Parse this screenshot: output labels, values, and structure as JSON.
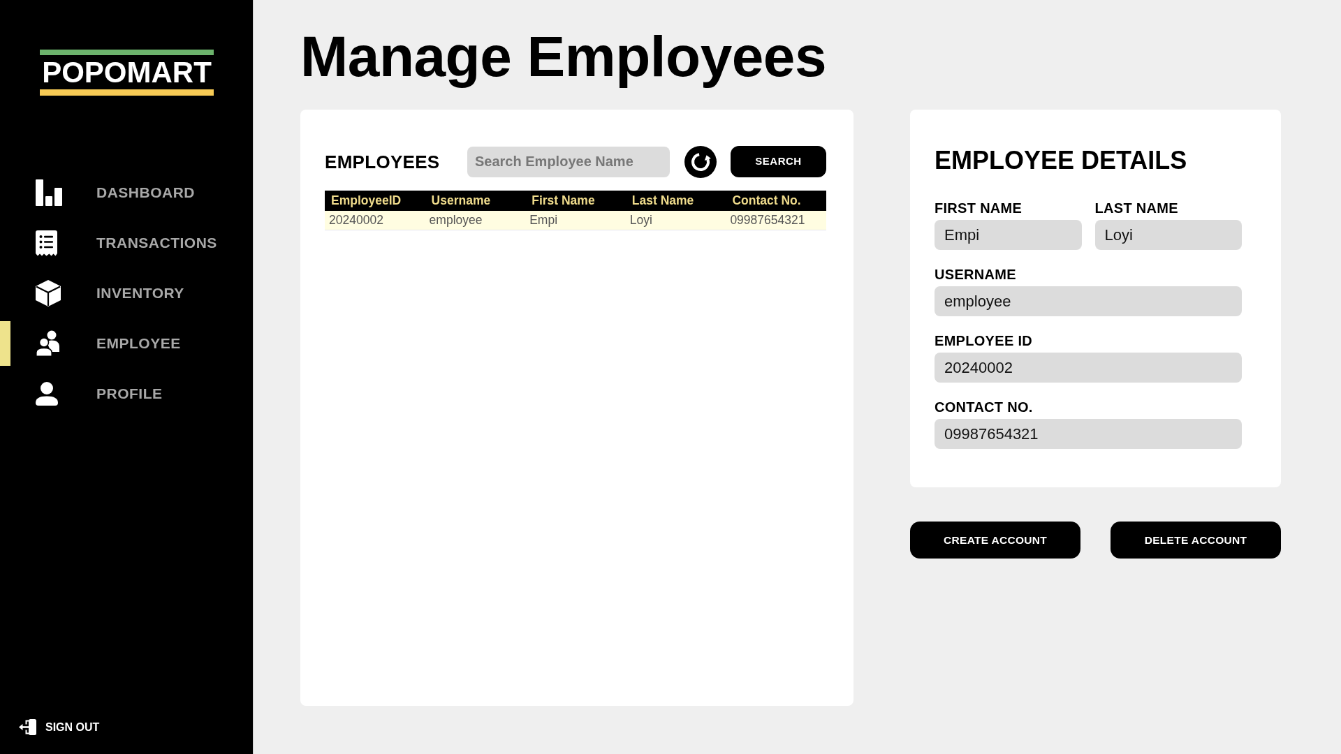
{
  "sidebar": {
    "logo": "POPOMART",
    "items": [
      {
        "label": "DASHBOARD",
        "selected": false
      },
      {
        "label": "TRANSACTIONS",
        "selected": false
      },
      {
        "label": "INVENTORY",
        "selected": false
      },
      {
        "label": "EMPLOYEE",
        "selected": true
      },
      {
        "label": "PROFILE",
        "selected": false
      }
    ],
    "sign_out": "SIGN OUT"
  },
  "page_title": "Manage Employees",
  "employees_panel": {
    "title": "EMPLOYEES",
    "search": {
      "placeholder": "Search Employee Name"
    },
    "search_button": "SEARCH",
    "table": {
      "columns": [
        "EmployeeID",
        "Username",
        "First Name",
        "Last Name",
        "Contact No."
      ],
      "rows": [
        {
          "cells": [
            "20240002",
            "employee",
            "Empi",
            "Loyi",
            "09987654321"
          ],
          "selected": true
        }
      ]
    }
  },
  "details_panel": {
    "title": "EMPLOYEE DETAILS",
    "rows": [
      [
        {
          "label": "FIRST NAME",
          "value": "Empi"
        },
        {
          "label": "LAST NAME",
          "value": "Loyi"
        }
      ],
      [
        {
          "label": "USERNAME",
          "value": "employee"
        }
      ],
      [
        {
          "label": "EMPLOYEE ID",
          "value": "20240002"
        }
      ],
      [
        {
          "label": "CONTACT NO.",
          "value": "09987654321"
        }
      ]
    ]
  },
  "actions": [
    "CREATE ACCOUNT",
    "DELETE ACCOUNT"
  ]
}
